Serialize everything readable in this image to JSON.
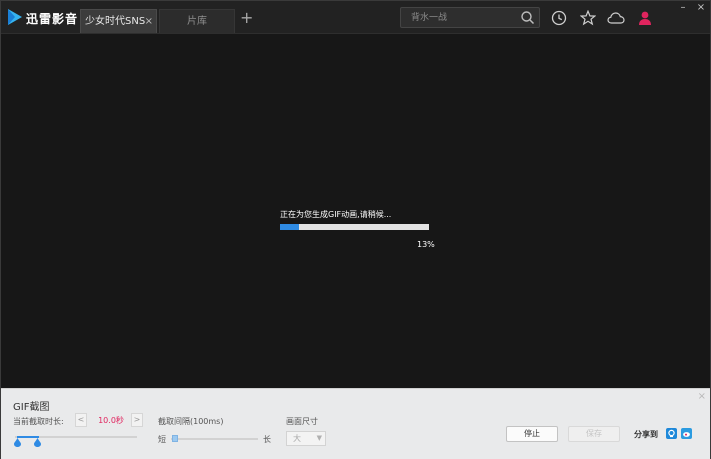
{
  "app": {
    "name": "迅雷影音"
  },
  "tabs": [
    {
      "label": "少女时代SNSD",
      "close": "×"
    },
    {
      "label": "片库"
    }
  ],
  "tab_add": "+",
  "search": {
    "placeholder": "背水一战"
  },
  "window": {
    "minimize": "–",
    "close": "×"
  },
  "progress": {
    "message": "正在为您生成GIF动画,请稍候...",
    "percent_label": "13%",
    "fraction": 0.13
  },
  "gif_panel": {
    "title": "GIF截图",
    "close": "×",
    "duration_label": "当前截取时长:",
    "duration_value": "10.0秒",
    "decrease": "<",
    "increase": ">",
    "interval_label": "截取间隔(100ms)",
    "interval_short": "短",
    "interval_long": "长",
    "size_label": "画面尺寸",
    "size_value": "大",
    "stop_label": "停止",
    "save_label": "保存",
    "share_label": "分享到"
  },
  "colors": {
    "accent": "#2f8be4",
    "duration_value": "#e0245e",
    "avatar": "#e0245e",
    "logo": "#35b3f0"
  },
  "icons": [
    "xunlei-logo-icon",
    "search-icon",
    "history-icon",
    "star-icon",
    "cloud-icon",
    "user-icon",
    "qzone-share-icon",
    "weibo-share-icon"
  ]
}
